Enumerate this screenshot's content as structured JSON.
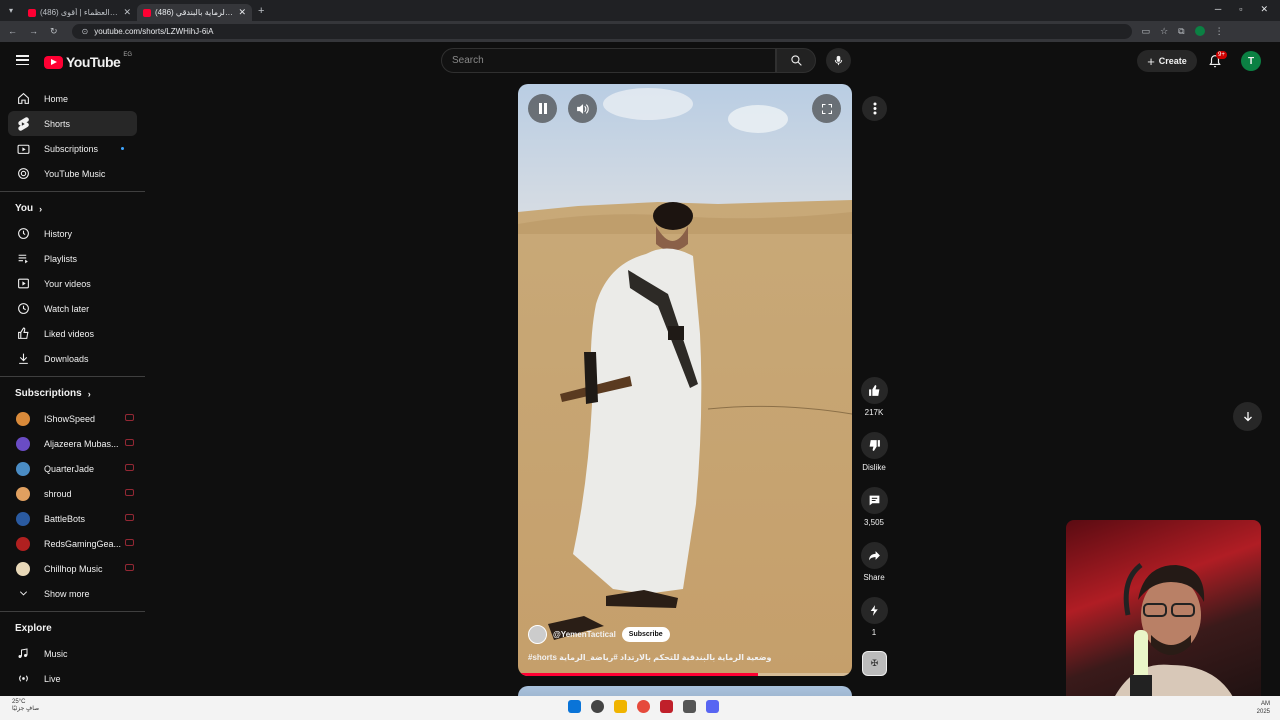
{
  "browser": {
    "tabs": [
      {
        "title": "(486) بيع سلام والعظماء | أقوى ...",
        "active": false
      },
      {
        "title": "(486) وضعية الرماية بالبندقي",
        "active": true
      }
    ],
    "new_tab": "+",
    "url": "youtube.com/shorts/LZWHihJ-6iA"
  },
  "header": {
    "logo_text": "YouTube",
    "country": "EG",
    "search_placeholder": "Search",
    "create_label": "Create",
    "notif_count": "9+",
    "account_initial": "T"
  },
  "sidebar": {
    "main": [
      {
        "label": "Home",
        "icon": "home-icon"
      },
      {
        "label": "Shorts",
        "icon": "shorts-icon",
        "active": true
      },
      {
        "label": "Subscriptions",
        "icon": "subscriptions-icon"
      },
      {
        "label": "YouTube Music",
        "icon": "music-icon"
      }
    ],
    "you_heading": "You",
    "you": [
      {
        "label": "History",
        "icon": "history-icon"
      },
      {
        "label": "Playlists",
        "icon": "playlists-icon"
      },
      {
        "label": "Your videos",
        "icon": "your-videos-icon"
      },
      {
        "label": "Watch later",
        "icon": "clock-icon"
      },
      {
        "label": "Liked videos",
        "icon": "thumbs-up-icon"
      },
      {
        "label": "Downloads",
        "icon": "download-icon"
      }
    ],
    "subs_heading": "Subscriptions",
    "subs": [
      {
        "label": "IShowSpeed",
        "color": "#d98a3a"
      },
      {
        "label": "Aljazeera Mubas...",
        "color": "#6a4cc4"
      },
      {
        "label": "QuarterJade",
        "color": "#4a8cc4"
      },
      {
        "label": "shroud",
        "color": "#e0a060"
      },
      {
        "label": "BattleBots",
        "color": "#2a5aa0"
      },
      {
        "label": "RedsGamingGea...",
        "color": "#b02020"
      },
      {
        "label": "Chillhop Music",
        "color": "#e8d8b8"
      }
    ],
    "show_more": "Show more",
    "explore_heading": "Explore",
    "explore": [
      {
        "label": "Music",
        "icon": "music-note-icon"
      },
      {
        "label": "Live",
        "icon": "live-icon"
      }
    ]
  },
  "short": {
    "channel": "@YemenTactical",
    "subscribe_label": "Subscribe",
    "caption": "#shorts وضعية الرماية بالبندقية للتحكم بالارتداد #رياضة_الرماية",
    "progress": 0.72,
    "likes": "217K",
    "dislike_label": "Dislike",
    "comments": "3,505",
    "share_label": "Share",
    "remix_count": "1"
  },
  "taskbar": {
    "weather_temp": "25°C",
    "weather_text": "صافٍ جزئيًا",
    "time": "AM",
    "date": "2025"
  }
}
